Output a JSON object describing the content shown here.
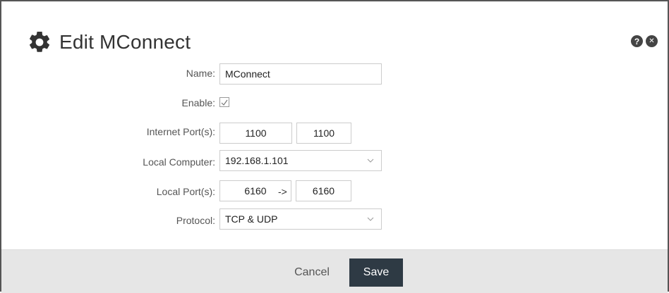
{
  "dialog": {
    "title": "Edit MConnect",
    "icons": {
      "header": "gear-icon",
      "help": "help-icon",
      "close": "close-icon"
    },
    "help_glyph": "?",
    "close_glyph": "✕"
  },
  "form": {
    "name": {
      "label": "Name:",
      "value": "MConnect"
    },
    "enable": {
      "label": "Enable:",
      "checked": true
    },
    "internet_ports": {
      "label": "Internet Port(s):",
      "start": "1100",
      "arrow": "->",
      "end": "1100"
    },
    "local_computer": {
      "label": "Local Computer:",
      "value": "192.168.1.101"
    },
    "local_ports": {
      "label": "Local Port(s):",
      "start": "6160",
      "arrow": "->",
      "end": "6160"
    },
    "protocol": {
      "label": "Protocol:",
      "value": "TCP & UDP"
    }
  },
  "footer": {
    "cancel_label": "Cancel",
    "save_label": "Save"
  },
  "colors": {
    "save_bg": "#2e3a44",
    "footer_bg": "#e6e6e6",
    "border": "#cccccc"
  }
}
